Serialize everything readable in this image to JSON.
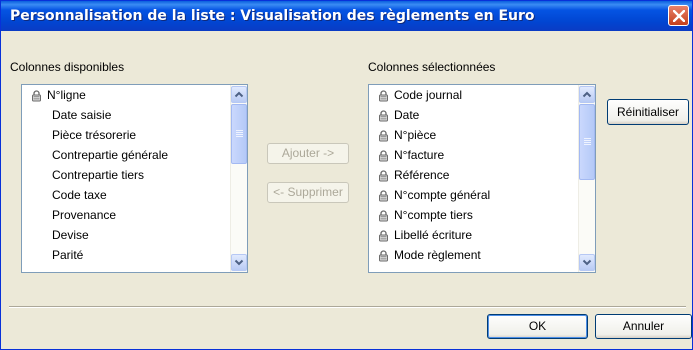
{
  "window": {
    "title": "Personnalisation de la liste : Visualisation des règlements en Euro"
  },
  "available": {
    "label": "Colonnes disponibles",
    "items": [
      {
        "text": "N°ligne",
        "locked": true
      },
      {
        "text": "Date saisie",
        "locked": false
      },
      {
        "text": "Pièce trésorerie",
        "locked": false
      },
      {
        "text": "Contrepartie générale",
        "locked": false
      },
      {
        "text": "Contrepartie tiers",
        "locked": false
      },
      {
        "text": "Code taxe",
        "locked": false
      },
      {
        "text": "Provenance",
        "locked": false
      },
      {
        "text": "Devise",
        "locked": false
      },
      {
        "text": "Parité",
        "locked": false
      }
    ]
  },
  "selected": {
    "label": "Colonnes sélectionnées",
    "items": [
      {
        "text": "Code journal",
        "locked": true
      },
      {
        "text": "Date",
        "locked": true
      },
      {
        "text": "N°pièce",
        "locked": true
      },
      {
        "text": "N°facture",
        "locked": true
      },
      {
        "text": "Référence",
        "locked": true
      },
      {
        "text": "N°compte général",
        "locked": true
      },
      {
        "text": "N°compte tiers",
        "locked": true
      },
      {
        "text": "Libellé écriture",
        "locked": true
      },
      {
        "text": "Mode règlement",
        "locked": true
      }
    ]
  },
  "buttons": {
    "add": "Ajouter ->",
    "remove": "<- Supprimer",
    "reset": "Réinitialiser",
    "ok": "OK",
    "cancel": "Annuler"
  },
  "icons": {
    "locked_item": "padlock-icon",
    "close": "close-icon",
    "scroll_up": "chevron-up-icon",
    "scroll_down": "chevron-down-icon"
  },
  "colors": {
    "titlebar": "#0554e3",
    "close_button": "#d4552f",
    "dialog_background": "#ece9d8",
    "list_border": "#7f9db9"
  }
}
